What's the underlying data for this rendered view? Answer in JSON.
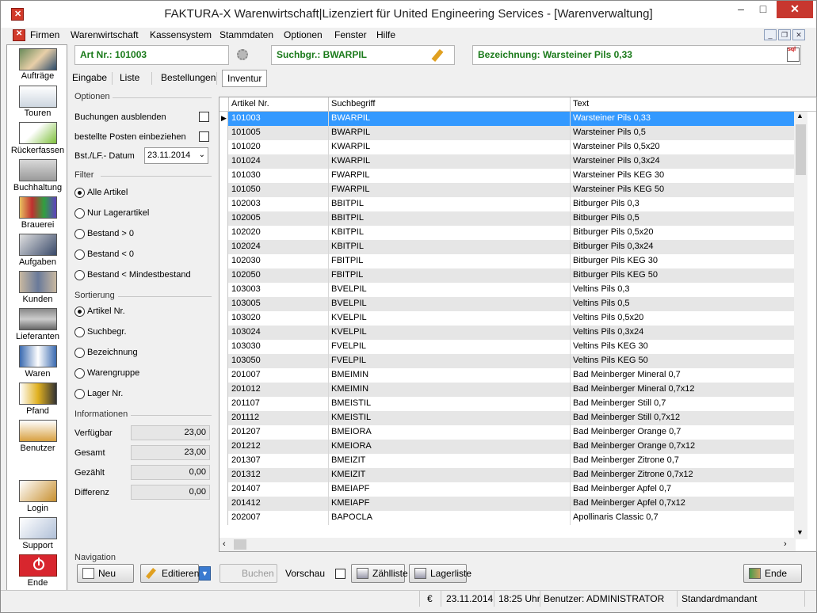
{
  "window": {
    "title": "FAKTURA-X Warenwirtschaft|Lizenziert für United Engineering Services - [Warenverwaltung]"
  },
  "menu": [
    "Firmen",
    "Warenwirtschaft",
    "Kassensystem",
    "Stammdaten",
    "Optionen",
    "Fenster",
    "Hilfe"
  ],
  "sidebar": [
    {
      "label": "Aufträge",
      "icon": "headset-agent-icon"
    },
    {
      "label": "Touren",
      "icon": "truck-icon"
    },
    {
      "label": "Rückerfassen",
      "icon": "checklist-icon"
    },
    {
      "label": "Buchhaltung",
      "icon": "money-icon"
    },
    {
      "label": "Brauerei",
      "icon": "brewery-chart-icon"
    },
    {
      "label": "Aufgaben",
      "icon": "tasks-icon"
    },
    {
      "label": "Kunden",
      "icon": "customers-icon"
    },
    {
      "label": "Lieferanten",
      "icon": "suppliers-icon"
    },
    {
      "label": "Waren",
      "icon": "goods-icon"
    },
    {
      "label": "Pfand",
      "icon": "crate-icon"
    },
    {
      "label": "Benutzer",
      "icon": "user-icon"
    },
    {
      "label": "Login",
      "icon": "key-icon"
    },
    {
      "label": "Support",
      "icon": "handshake-icon"
    },
    {
      "label": "Ende",
      "icon": "power-icon"
    }
  ],
  "info": {
    "artnr": "Art Nr.: 101003",
    "suchbgr": "Suchbgr.: BWARPIL",
    "bezeichnung": "Bezeichnung: Warsteiner Pils 0,33"
  },
  "tabs": [
    "Eingabe",
    "Liste",
    "Bestellungen",
    "Inventur"
  ],
  "options": {
    "title": "Optionen",
    "buchungen": "Buchungen ausblenden",
    "bestellte": "bestellte Posten einbeziehen",
    "datum_label": "Bst./LF.- Datum",
    "datum_value": "23.11.2014"
  },
  "filter": {
    "title": "Filter",
    "items": [
      "Alle Artikel",
      "Nur Lagerartikel",
      "Bestand > 0",
      "Bestand < 0",
      "Bestand < Mindestbestand"
    ]
  },
  "sort": {
    "title": "Sortierung",
    "items": [
      "Artikel Nr.",
      "Suchbegr.",
      "Bezeichnung",
      "Warengruppe",
      "Lager Nr."
    ]
  },
  "informationen": {
    "title": "Informationen",
    "rows": [
      {
        "label": "Verfügbar",
        "value": "23,00"
      },
      {
        "label": "Gesamt",
        "value": "23,00"
      },
      {
        "label": "Gezählt",
        "value": "0,00"
      },
      {
        "label": "Differenz",
        "value": "0,00"
      }
    ]
  },
  "grid": {
    "columns": [
      "Artikel Nr.",
      "Suchbegriff",
      "Text"
    ],
    "rows": [
      [
        "101003",
        "BWARPIL",
        "Warsteiner Pils 0,33"
      ],
      [
        "101005",
        "BWARPIL",
        "Warsteiner Pils 0,5"
      ],
      [
        "101020",
        "KWARPIL",
        "Warsteiner Pils 0,5x20"
      ],
      [
        "101024",
        "KWARPIL",
        "Warsteiner Pils 0,3x24"
      ],
      [
        "101030",
        "FWARPIL",
        "Warsteiner Pils KEG 30"
      ],
      [
        "101050",
        "FWARPIL",
        "Warsteiner Pils KEG 50"
      ],
      [
        "102003",
        "BBITPIL",
        "Bitburger Pils 0,3"
      ],
      [
        "102005",
        "BBITPIL",
        "Bitburger Pils 0,5"
      ],
      [
        "102020",
        "KBITPIL",
        "Bitburger Pils 0,5x20"
      ],
      [
        "102024",
        "KBITPIL",
        "Bitburger Pils 0,3x24"
      ],
      [
        "102030",
        "FBITPIL",
        "Bitburger Pils KEG 30"
      ],
      [
        "102050",
        "FBITPIL",
        "Bitburger Pils KEG 50"
      ],
      [
        "103003",
        "BVELPIL",
        "Veltins Pils 0,3"
      ],
      [
        "103005",
        "BVELPIL",
        "Veltins Pils 0,5"
      ],
      [
        "103020",
        "KVELPIL",
        "Veltins Pils 0,5x20"
      ],
      [
        "103024",
        "KVELPIL",
        "Veltins Pils 0,3x24"
      ],
      [
        "103030",
        "FVELPIL",
        "Veltins Pils KEG 30"
      ],
      [
        "103050",
        "FVELPIL",
        "Veltins Pils KEG 50"
      ],
      [
        "201007",
        "BMEIMIN",
        "Bad Meinberger Mineral 0,7"
      ],
      [
        "201012",
        "KMEIMIN",
        "Bad Meinberger Mineral 0,7x12"
      ],
      [
        "201107",
        "BMEISTIL",
        "Bad Meinberger Still 0,7"
      ],
      [
        "201112",
        "KMEISTIL",
        "Bad Meinberger Still 0,7x12"
      ],
      [
        "201207",
        "BMEIORA",
        "Bad Meinberger Orange 0,7"
      ],
      [
        "201212",
        "KMEIORA",
        "Bad Meinberger Orange 0,7x12"
      ],
      [
        "201307",
        "BMEIZIT",
        "Bad Meinberger Zitrone 0,7"
      ],
      [
        "201312",
        "KMEIZIT",
        "Bad Meinberger Zitrone 0,7x12"
      ],
      [
        "201407",
        "BMEIAPF",
        "Bad Meinberger Apfel 0,7"
      ],
      [
        "201412",
        "KMEIAPF",
        "Bad Meinberger Apfel 0,7x12"
      ],
      [
        "202007",
        "BAPOCLA",
        "Apollinaris Classic 0,7"
      ]
    ]
  },
  "nav": {
    "title": "Navigation",
    "neu": "Neu",
    "editieren": "Editieren",
    "buchen": "Buchen",
    "vorschau": "Vorschau",
    "zaehlliste": "Zählliste",
    "lagerliste": "Lagerliste",
    "ende": "Ende"
  },
  "status": {
    "currency": "€",
    "date": "23.11.2014",
    "time": "18:25 Uhr",
    "user": "Benutzer: ADMINISTRATOR",
    "mandant": "Standardmandant"
  },
  "colors": {
    "selection": "#3399ff",
    "info_text": "#1a7a1a",
    "close": "#c7372f"
  }
}
